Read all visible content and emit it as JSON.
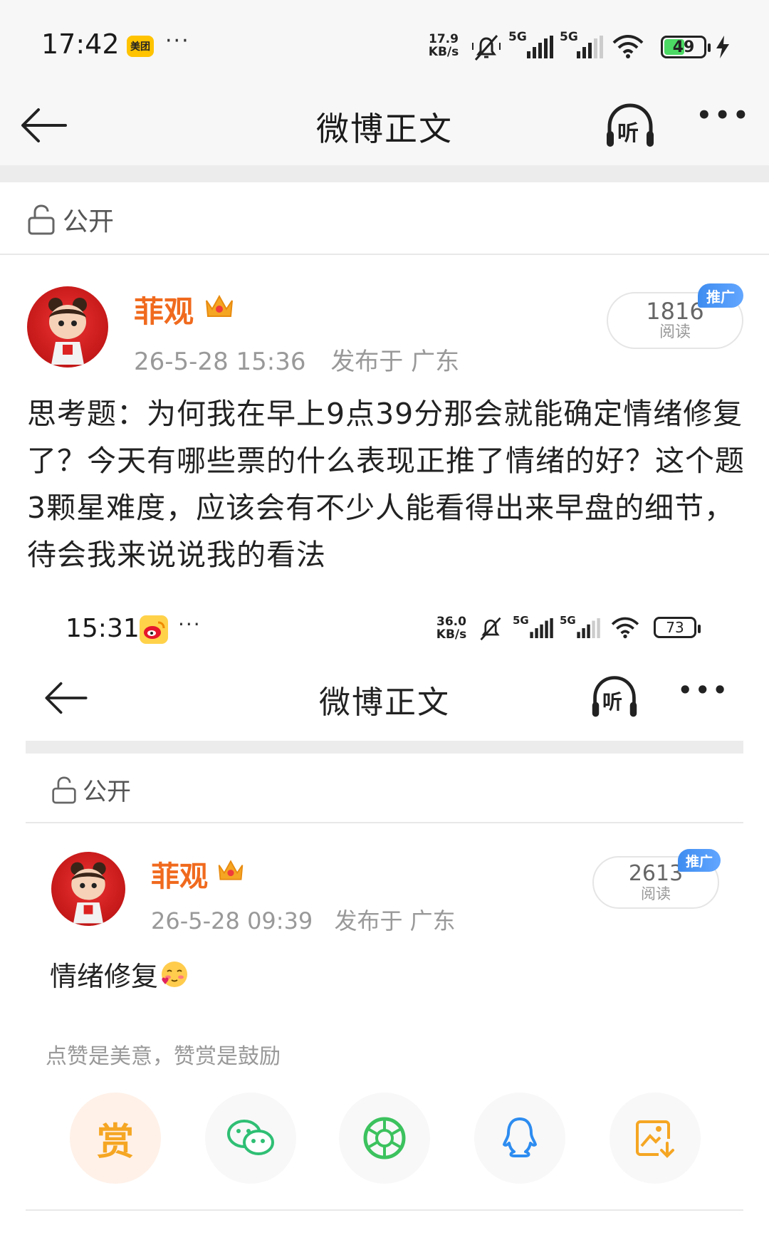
{
  "status_bar": {
    "time": "17:42",
    "app_badge": "美团",
    "more_dots": "···",
    "net_speed_value": "17.9",
    "net_speed_unit": "KB/s",
    "signal_1": "5G",
    "signal_2": "5G",
    "battery": "49"
  },
  "header": {
    "title": "微博正文",
    "listen_label": "听",
    "more_dots": "•••"
  },
  "visibility_label": "公开",
  "post": {
    "author": "菲观",
    "date": "26-5-28 15:36",
    "location": "发布于 广东",
    "read_count": "1816",
    "read_label": "阅读",
    "promo_label": "推广",
    "text": "思考题：为何我在早上9点39分那会就能确定情绪修复了？今天有哪些票的什么表现正推了情绪的好？这个题3颗星难度，应该会有不少人能看得出来早盘的细节，待会我来说说我的看法"
  },
  "embedded_screenshot": {
    "status_bar": {
      "time": "15:31",
      "more_dots": "···",
      "net_speed_value": "36.0",
      "net_speed_unit": "KB/s",
      "signal_1": "5G",
      "signal_2": "5G",
      "battery": "73"
    },
    "header": {
      "title": "微博正文",
      "listen_label": "听",
      "more_dots": "•••"
    },
    "visibility_label": "公开",
    "post": {
      "author": "菲观",
      "date": "26-5-28 09:39",
      "location": "发布于 广东",
      "read_count": "2613",
      "read_label": "阅读",
      "promo_label": "推广",
      "text": "情绪修复"
    },
    "reward_hint": "点赞是美意，赞赏是鼓励",
    "reward_label": "赏"
  },
  "colors": {
    "username": "#f06a1e",
    "promo": "#3e8cf0",
    "wechat": "#2fbf74",
    "moments": "#3cc25e",
    "qq": "#2d8cf0",
    "save": "#f5a623",
    "battery_fill": "#4cd964"
  }
}
